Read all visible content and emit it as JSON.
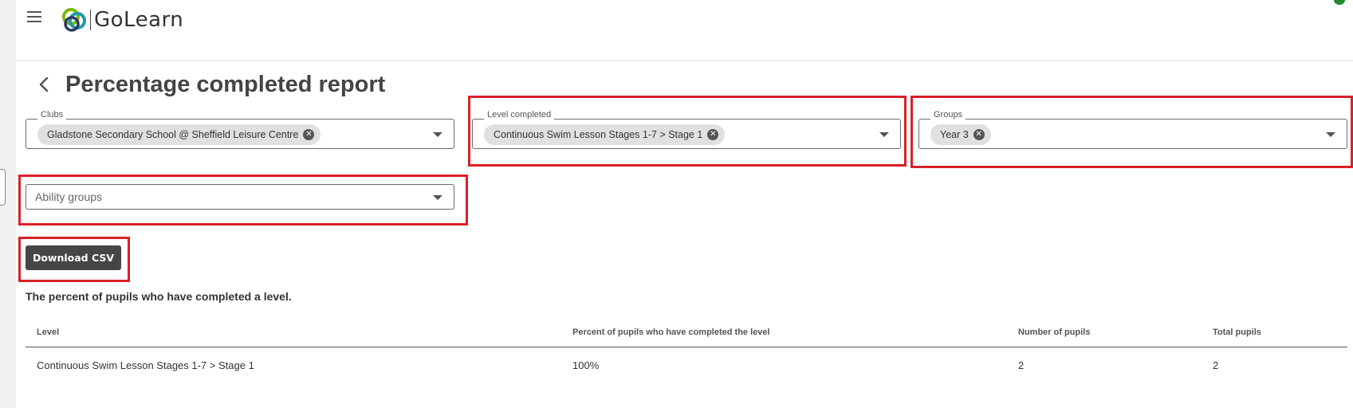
{
  "app": {
    "brand_name": "GoLearn",
    "brand_colors": {
      "green": "#7ab800",
      "teal": "#1a9aa8",
      "navy": "#2b3a67"
    }
  },
  "header": {
    "menu_icon": "hamburger-icon",
    "status_color": "#1e8a2b"
  },
  "page": {
    "title": "Percentage completed report",
    "back_icon": "chevron-left-icon"
  },
  "filters": {
    "clubs": {
      "label": "Clubs",
      "chips": [
        "Gladstone Secondary School @ Sheffield Leisure Centre"
      ]
    },
    "level_completed": {
      "label": "Level completed",
      "chips": [
        "Continuous Swim Lesson Stages 1-7 > Stage 1"
      ]
    },
    "groups": {
      "label": "Groups",
      "chips": [
        "Year 3"
      ]
    },
    "ability_groups": {
      "placeholder": "Ability groups"
    }
  },
  "actions": {
    "download_csv_label": "Download CSV"
  },
  "report": {
    "description": "The percent of pupils who have completed a level.",
    "columns": [
      "Level",
      "Percent of pupils who have completed the level",
      "Number of pupils",
      "Total pupils"
    ],
    "rows": [
      [
        "Continuous Swim Lesson Stages 1-7 > Stage 1",
        "100%",
        "2",
        "2"
      ]
    ]
  },
  "annotation_color": "#d92027"
}
